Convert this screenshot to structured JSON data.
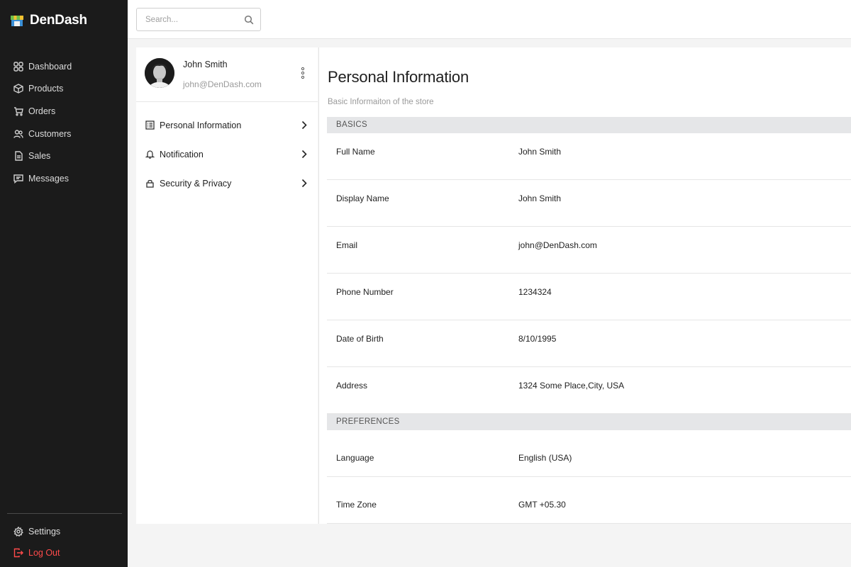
{
  "app": {
    "name": "DenDash"
  },
  "sidebar": {
    "items": [
      {
        "label": "Dashboard",
        "icon": "grid-icon"
      },
      {
        "label": "Products",
        "icon": "box-icon"
      },
      {
        "label": "Orders",
        "icon": "cart-icon"
      },
      {
        "label": "Customers",
        "icon": "users-icon"
      },
      {
        "label": "Sales",
        "icon": "document-icon"
      },
      {
        "label": "Messages",
        "icon": "chat-icon"
      }
    ],
    "bottom": [
      {
        "label": "Settings",
        "icon": "gear-icon"
      },
      {
        "label": "Log Out",
        "icon": "logout-icon",
        "color": "#ff4b4b"
      }
    ]
  },
  "search": {
    "placeholder": "Search...",
    "value": ""
  },
  "profile": {
    "name": "John Smith",
    "email": "john@DenDash.com",
    "menu": [
      {
        "label": "Personal Information",
        "icon": "list-icon"
      },
      {
        "label": "Notification",
        "icon": "bell-icon"
      },
      {
        "label": "Security & Privacy",
        "icon": "lock-icon"
      }
    ]
  },
  "main": {
    "title": "Personal Information",
    "subtitle": "Basic Informaiton of the store",
    "sections": [
      {
        "heading": "BASICS",
        "rows": [
          {
            "label": "Full Name",
            "value": "John Smith"
          },
          {
            "label": "Display Name",
            "value": "John Smith"
          },
          {
            "label": "Email",
            "value": "john@DenDash.com"
          },
          {
            "label": "Phone Number",
            "value": "1234324"
          },
          {
            "label": "Date of Birth",
            "value": "8/10/1995"
          },
          {
            "label": "Address",
            "value": "1324 Some Place,City, USA"
          }
        ]
      },
      {
        "heading": "PREFERENCES",
        "rows": [
          {
            "label": "Language",
            "value": "English (USA)"
          },
          {
            "label": "Time Zone",
            "value": "GMT +05.30"
          }
        ]
      }
    ]
  },
  "colors": {
    "sidebar_bg": "#1b1b1b",
    "logout": "#ff4b4b",
    "section_bg": "#e5e6e8"
  }
}
